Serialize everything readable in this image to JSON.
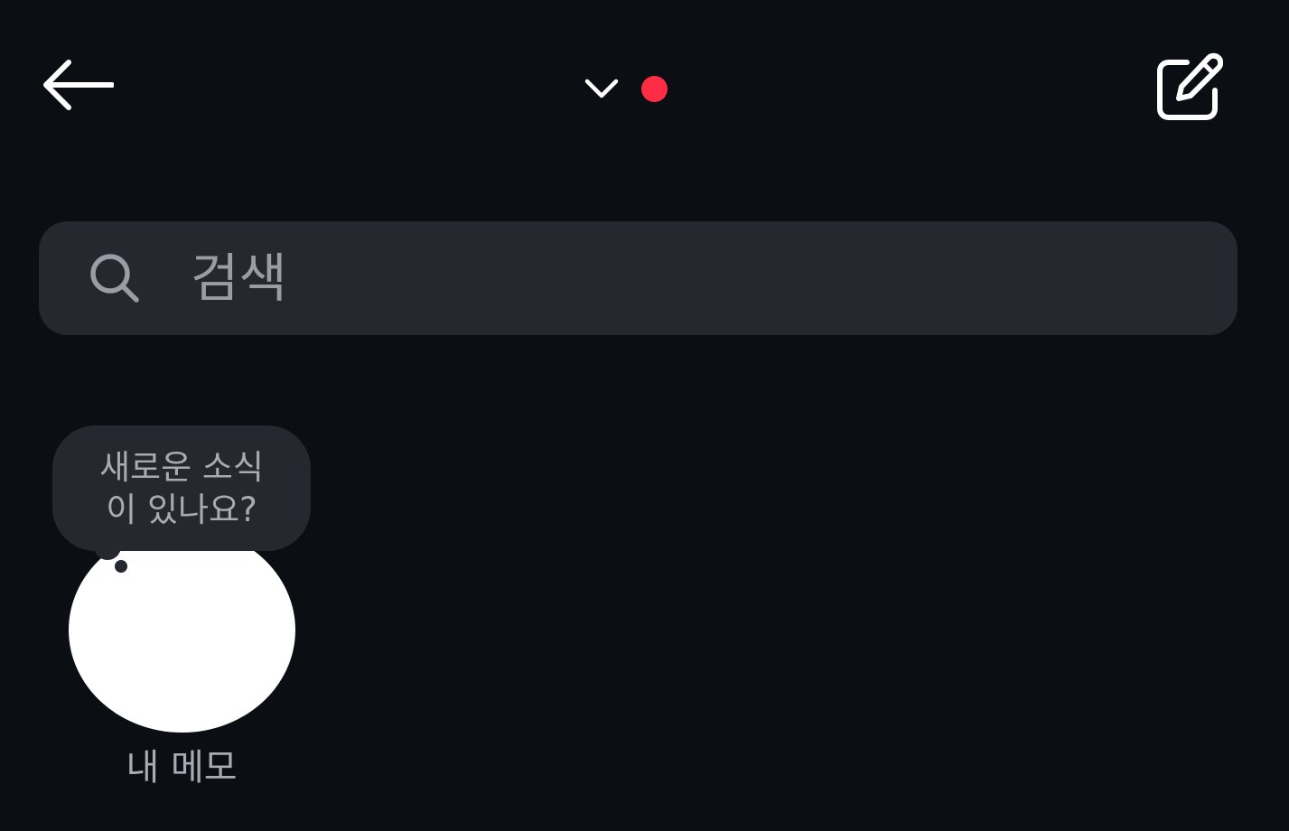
{
  "header": {
    "back_icon": "arrow-left-icon",
    "account_switcher_icon": "chevron-down-icon",
    "notification_dot_color": "#ff2d43",
    "compose_icon": "compose-edit-icon"
  },
  "search": {
    "placeholder": "검색",
    "icon": "search-icon"
  },
  "notes": [
    {
      "bubble_text": "새로운 소식\n이 있나요?",
      "label": "내 메모"
    }
  ]
}
